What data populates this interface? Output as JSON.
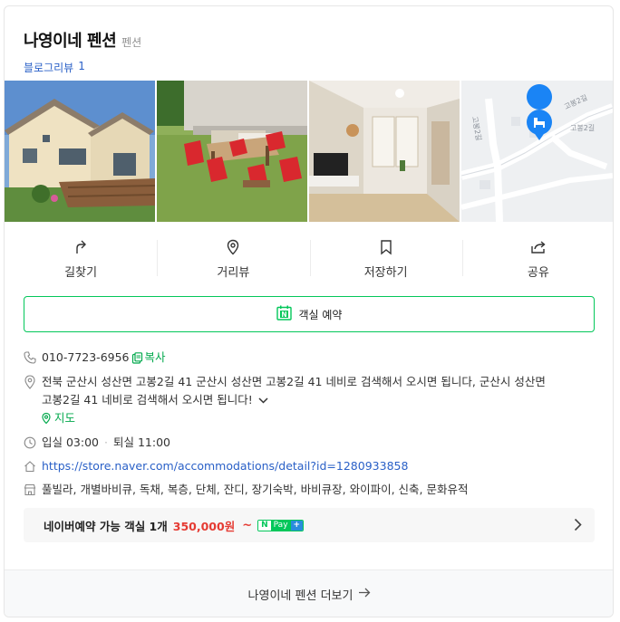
{
  "place": {
    "name": "나영이네 펜션",
    "category": "펜션",
    "blog_review_label": "블로그리뷰",
    "blog_review_count": "1"
  },
  "photos": [
    {
      "name": "exterior-photo"
    },
    {
      "name": "garden-photo"
    },
    {
      "name": "interior-photo"
    },
    {
      "name": "map-thumbnail",
      "road_label_1": "고봉2길",
      "road_label_2": "고봉2길",
      "road_label_3": "고봉2길"
    }
  ],
  "actions": [
    {
      "label": "길찾기",
      "icon": "directions-icon"
    },
    {
      "label": "거리뷰",
      "icon": "street-view-icon"
    },
    {
      "label": "저장하기",
      "icon": "bookmark-icon"
    },
    {
      "label": "공유",
      "icon": "share-icon"
    }
  ],
  "reserve_button": {
    "label": "객실 예약",
    "icon": "naver-calendar-icon"
  },
  "info": {
    "phone": "010-7723-6956",
    "copy_label": "복사",
    "address_line1": "전북 군산시 성산면 고봉2길 41 군산시 성산면 고봉2길 41 네비로 검색해서 오시면 됩니다, 군산시 성산면",
    "address_line2": "고봉2길 41 네비로 검색해서 오시면 됩니다!",
    "map_link": "지도",
    "checkin": "입실 03:00",
    "checkout": "퇴실 11:00",
    "website": "https://store.naver.com/accommodations/detail?id=1280933858",
    "amenities": "풀빌라, 개별바비큐, 독채, 복층, 단체, 잔디, 장기숙박, 바비큐장, 와이파이, 신축, 문화유적"
  },
  "booking": {
    "text": "네이버예약 가능 객실 1개",
    "price": "350,000원",
    "tilde": "~",
    "npay_n": "N",
    "npay_pay": "Pay",
    "npay_plus": "+"
  },
  "more_button": {
    "label": "나영이네 펜션 더보기"
  },
  "colors": {
    "accent_green": "#03c75a",
    "link_blue": "#2a60c7",
    "price_red": "#e53b33"
  }
}
